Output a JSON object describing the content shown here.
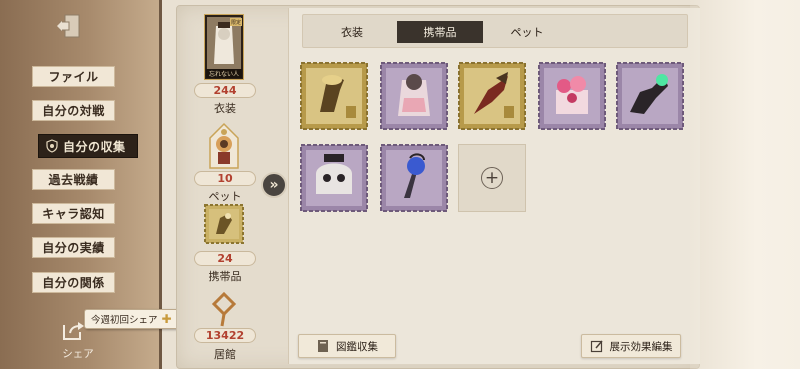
{
  "sidebar": {
    "items": [
      {
        "label": "ファイル"
      },
      {
        "label": "自分の対戦"
      },
      {
        "label": "自分の収集"
      },
      {
        "label": "過去戦績"
      },
      {
        "label": "キャラ認知"
      },
      {
        "label": "自分の実績"
      },
      {
        "label": "自分の関係"
      }
    ],
    "active_index": 2,
    "tooltip": "今週初回シェア",
    "share_label": "シェア"
  },
  "stats": {
    "costume": {
      "value": "244",
      "label": "衣装",
      "card_text": "忘れない人",
      "card_badge": "限定"
    },
    "pet": {
      "value": "10",
      "label": "ペット"
    },
    "accessory": {
      "value": "24",
      "label": "携帯品"
    },
    "residence": {
      "value": "13422",
      "label": "居館"
    }
  },
  "tabs": [
    {
      "label": "衣装"
    },
    {
      "label": "携帯品"
    },
    {
      "label": "ペット"
    }
  ],
  "active_tab": 1,
  "items": [
    {
      "icon": "golden-vase-item",
      "frame": "gold"
    },
    {
      "icon": "pink-dress-item",
      "frame": "purple"
    },
    {
      "icon": "red-blade-item",
      "frame": "gold"
    },
    {
      "icon": "pink-bouquet-item",
      "frame": "purple"
    },
    {
      "icon": "dark-claw-item",
      "frame": "purple"
    },
    {
      "icon": "ghost-cat-item",
      "frame": "purple"
    },
    {
      "icon": "blue-lantern-item",
      "frame": "purple"
    }
  ],
  "buttons": {
    "catalog": "図鑑収集",
    "edit_display": "展示効果編集"
  },
  "colors": {
    "accent_value": "#b24130",
    "active_tab": "#3a332c",
    "gold_frame": "#b79a4a",
    "purple_frame": "#9b86a8"
  }
}
